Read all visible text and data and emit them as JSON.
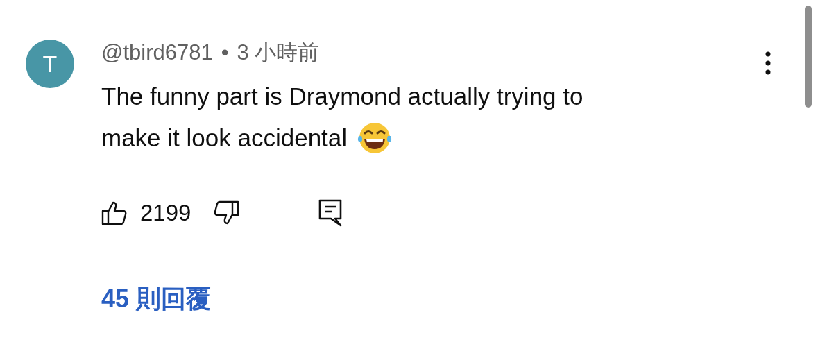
{
  "comment": {
    "avatar_letter": "T",
    "author": "@tbird6781",
    "separator": "•",
    "time": "3 小時前",
    "text_lines": [
      "The funny part is Draymond actually trying to",
      "make it look accidental"
    ],
    "likes": "2199",
    "replies": "45 則回覆"
  }
}
